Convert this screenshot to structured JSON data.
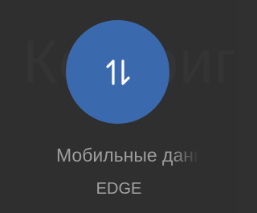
{
  "tile": {
    "background_label": "Конфигурация",
    "title": "Мобильные данные",
    "subtitle": "EDGE",
    "icon": "data-transfer-arrows-icon",
    "accent_color": "#3b69ad"
  }
}
